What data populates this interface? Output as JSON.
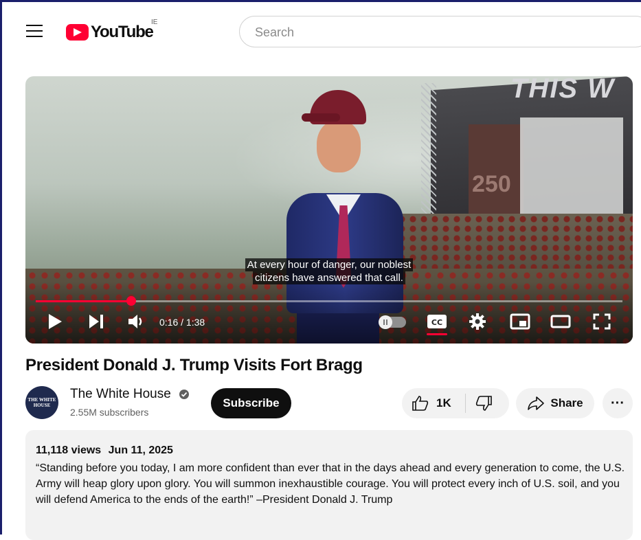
{
  "header": {
    "logo_text": "YouTube",
    "region": "IE",
    "search_placeholder": "Search"
  },
  "player": {
    "caption_line1": "At every hour of danger, our noblest",
    "caption_line2": "citizens have answered that call.",
    "time_display": "0:16 / 1:38",
    "progress_fraction": 0.163,
    "stage_text": "THIS W",
    "stage_number": "250"
  },
  "video": {
    "title": "President Donald J. Trump Visits Fort Bragg"
  },
  "channel": {
    "name": "The White House",
    "subscribers": "2.55M subscribers",
    "avatar_text": "THE WHITE HOUSE",
    "subscribe_label": "Subscribe"
  },
  "actions": {
    "like_count": "1K",
    "share_label": "Share",
    "more_label": "···"
  },
  "description": {
    "views": "11,118 views",
    "date": "Jun 11, 2025",
    "text": "“Standing before you today, I am more confident than ever that in the days ahead and every generation to come, the U.S. Army will heap glory upon glory. You will summon inexhaustible courage. You will protect every inch of U.S. soil, and you will defend America to the ends of the earth!” –President Donald J. Trump"
  },
  "colors": {
    "brand_red": "#ff0033",
    "frame": "#1b1f6b"
  }
}
